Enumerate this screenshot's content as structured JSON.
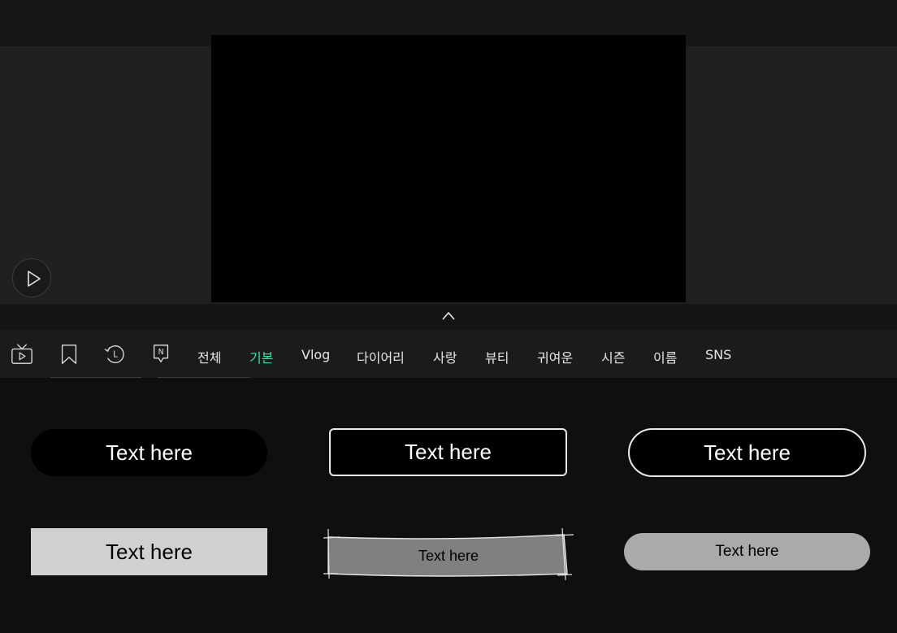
{
  "player": {
    "play_icon": "play-icon",
    "collapse_icon": "chevron-up-icon"
  },
  "toolbar": {
    "icons": [
      "tv-play-icon",
      "bookmark-icon",
      "history-l-icon",
      "new-badge-icon"
    ],
    "history_letter": "L",
    "new_letter": "N",
    "tabs": [
      "전체",
      "기본",
      "Vlog",
      "다이어리",
      "사랑",
      "뷰티",
      "귀여운",
      "시즌",
      "이름",
      "SNS"
    ],
    "active_tab": "기본",
    "active_color": "#31e3a2"
  },
  "templates": [
    {
      "label": "Text here",
      "style": "black-pill"
    },
    {
      "label": "Text here",
      "style": "black-outline-rect"
    },
    {
      "label": "Text here",
      "style": "black-outline-pill"
    },
    {
      "label": "Text here",
      "style": "light-gray-rect"
    },
    {
      "label": "Text here",
      "style": "sketch-gray"
    },
    {
      "label": "Text here",
      "style": "gray-pill"
    }
  ]
}
